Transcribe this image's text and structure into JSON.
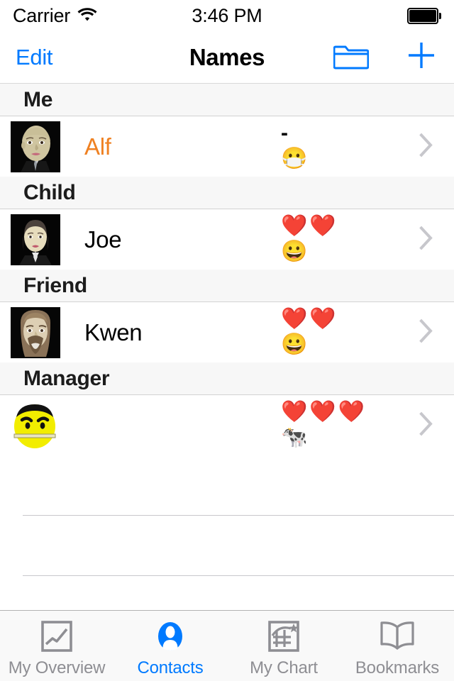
{
  "status_bar": {
    "carrier": "Carrier",
    "wifi_icon": "wifi-icon",
    "time": "3:46 PM",
    "battery_icon": "battery-full-icon"
  },
  "nav_bar": {
    "edit_label": "Edit",
    "title": "Names",
    "folder_icon": "folder-icon",
    "add_icon": "plus-icon",
    "tint_color": "#007AFF"
  },
  "list": {
    "sections": [
      {
        "header": "Me",
        "rows": [
          {
            "name": "Alf",
            "name_color": "#EF8122",
            "avatar_icon": "avatar-photo-alf",
            "rating_symbol": "-",
            "hearts": 0,
            "mood_emoji": "😷",
            "mood_name": "face-with-medical-mask-emoji",
            "disclosure_icon": "chevron-right-icon"
          }
        ]
      },
      {
        "header": "Child",
        "rows": [
          {
            "name": "Joe",
            "name_color": "#000000",
            "avatar_icon": "avatar-photo-joe",
            "rating_symbol": "",
            "hearts": 2,
            "mood_emoji": "😀",
            "mood_name": "grinning-face-emoji",
            "disclosure_icon": "chevron-right-icon"
          }
        ]
      },
      {
        "header": "Friend",
        "rows": [
          {
            "name": "Kwen",
            "name_color": "#000000",
            "avatar_icon": "avatar-photo-kwen",
            "rating_symbol": "",
            "hearts": 2,
            "mood_emoji": "😀",
            "mood_name": "grinning-face-emoji",
            "disclosure_icon": "chevron-right-icon"
          }
        ]
      },
      {
        "header": "Manager",
        "rows": [
          {
            "name": "",
            "name_color": "#000000",
            "avatar_icon": "avatar-smiley-manager",
            "rating_symbol": "",
            "hearts": 3,
            "mood_emoji": "🐄",
            "mood_name": "cow-emoji",
            "disclosure_icon": "chevron-right-icon"
          }
        ]
      }
    ],
    "heart_emoji": "❤️",
    "empty_rows": 3
  },
  "tab_bar": {
    "tabs": [
      {
        "label": "My Overview",
        "icon": "chart-overview-icon",
        "active": false
      },
      {
        "label": "Contacts",
        "icon": "contacts-person-icon",
        "active": true
      },
      {
        "label": "My Chart",
        "icon": "my-chart-icon",
        "active": false
      },
      {
        "label": "Bookmarks",
        "icon": "book-bookmarks-icon",
        "active": false
      }
    ],
    "active_color": "#007AFF",
    "inactive_color": "#8E8E93"
  }
}
